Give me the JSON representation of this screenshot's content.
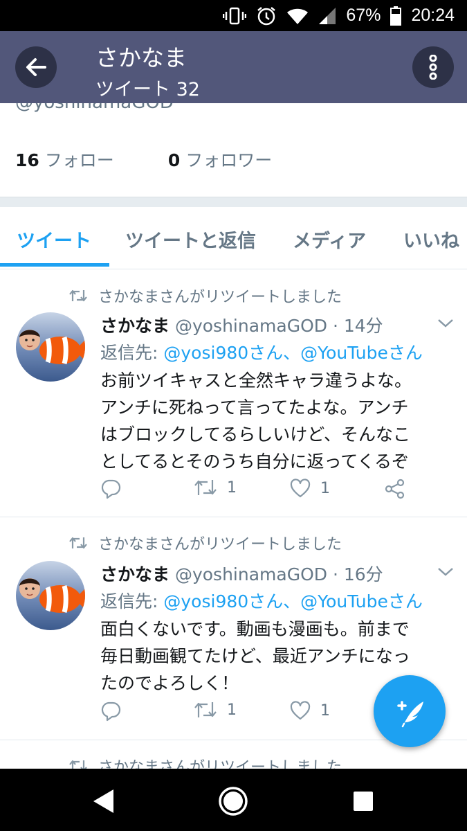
{
  "status_bar": {
    "battery": "67%",
    "time": "20:24",
    "icons": [
      "vibrate-icon",
      "alarm-icon",
      "wifi-icon",
      "signal-icon",
      "battery-icon"
    ]
  },
  "header": {
    "title": "さかなま",
    "subtitle": "ツイート 32",
    "back_icon": "back-arrow-icon",
    "more_icon": "more-vertical-icon"
  },
  "profile": {
    "handle": "@yoshinamaGOD",
    "following_count": "16",
    "following_label": "フォロー",
    "followers_count": "0",
    "followers_label": "フォロワー"
  },
  "tabs": [
    {
      "label": "ツイート",
      "active": true
    },
    {
      "label": "ツイートと返信",
      "active": false
    },
    {
      "label": "メディア",
      "active": false
    },
    {
      "label": "いいね",
      "active": false
    }
  ],
  "tweets": [
    {
      "retweet_label": "さかなまさんがリツイートしました",
      "name": "さかなま",
      "handle_time": "@yoshinamaGOD · 14分",
      "reply_prefix": "返信先:",
      "reply_targets": "@yosi980さん、@YouTubeさん",
      "lines": [
        "お前ツイキャスと全然キャラ違うよな。",
        "アンチに死ねって言ってたよな。アンチ",
        "はブロックしてるらしいけど、そんなこ",
        "としてるとそのうち自分に返ってくるぞ"
      ],
      "retweets": "1",
      "likes": "1"
    },
    {
      "retweet_label": "さかなまさんがリツイートしました",
      "name": "さかなま",
      "handle_time": "@yoshinamaGOD · 16分",
      "reply_prefix": "返信先:",
      "reply_targets": "@yosi980さん、@YouTubeさん",
      "lines": [
        "面白くないです。動画も漫画も。前まで",
        "毎日動画観てたけど、最近アンチになっ",
        "たのでよろしく！"
      ],
      "retweets": "1",
      "likes": "1"
    },
    {
      "retweet_label": "さかなまさんがリツイートしました"
    }
  ],
  "fab": {
    "icon": "compose-tweet-icon"
  },
  "nav": [
    "nav-back-icon",
    "nav-home-icon",
    "nav-recents-icon"
  ],
  "colors": {
    "accent": "#1da1f2",
    "header_bg": "#52577a",
    "secondary_text": "#657786"
  }
}
